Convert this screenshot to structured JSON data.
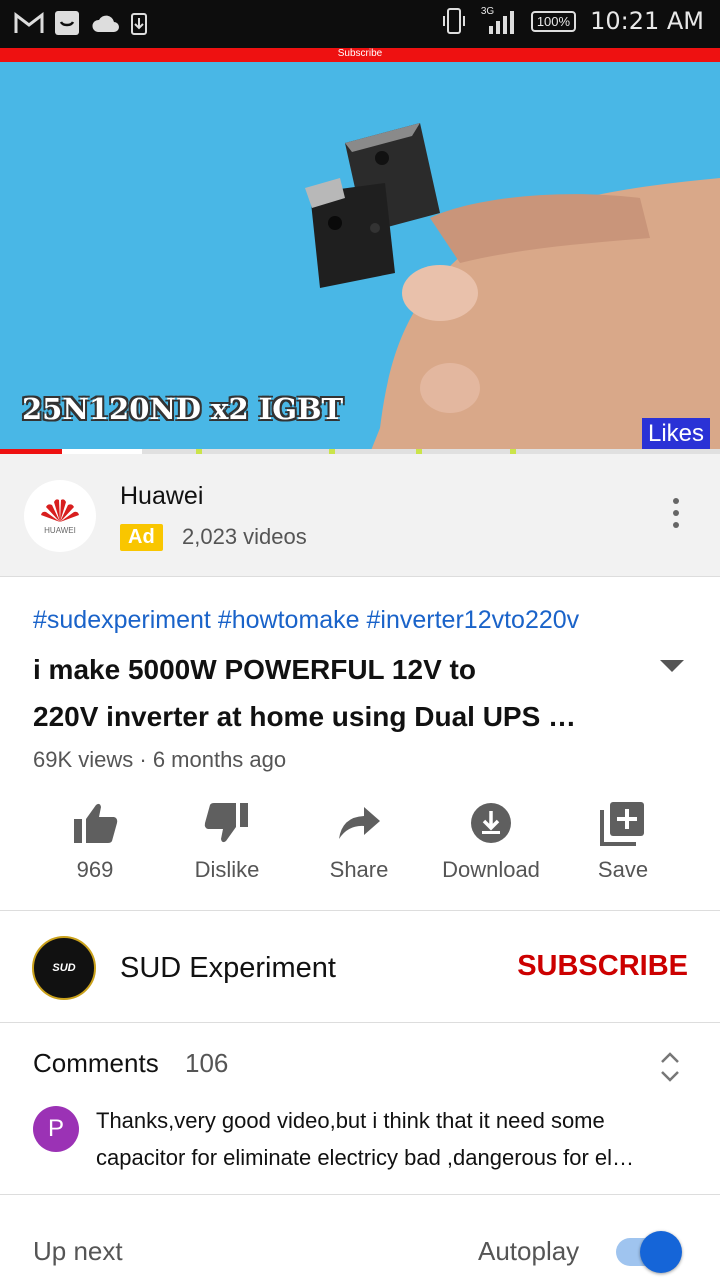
{
  "status_bar": {
    "time": "10:21 AM",
    "network": "3G",
    "battery": "100%"
  },
  "video": {
    "top_text": "Subscribe",
    "overlay_text": "25N120ND x2 IGBT",
    "likes_overlay": "Likes",
    "progress_fraction": 0.086
  },
  "ad": {
    "name": "Huawei",
    "logo_text": "HUAWEI",
    "badge": "Ad",
    "videos": "2,023 videos"
  },
  "video_info": {
    "hashtags": "#sudexperiment #howtomake #inverter12vto220v",
    "title_line1": "i make 5000W POWERFUL 12V to",
    "title_line2": "220V inverter at home using Dual UPS …",
    "meta": "69K views · 6 months ago"
  },
  "actions": [
    {
      "label": "969",
      "icon": "thumbs-up-icon"
    },
    {
      "label": "Dislike",
      "icon": "thumbs-down-icon"
    },
    {
      "label": "Share",
      "icon": "share-arrow-icon"
    },
    {
      "label": "Download",
      "icon": "download-icon"
    },
    {
      "label": "Save",
      "icon": "add-to-playlist-icon"
    }
  ],
  "channel": {
    "name": "SUD Experiment",
    "avatar_text": "SUD",
    "subscribe_label": "SUBSCRIBE"
  },
  "comments": {
    "heading": "Comments",
    "count": "106",
    "top_comment": {
      "avatar_letter": "P",
      "line1": "Thanks,very good video,but i think that it need some",
      "line2": "capacitor for eliminate electricy bad ,dangerous for el…"
    }
  },
  "up_next": {
    "label": "Up next",
    "autoplay_label": "Autoplay",
    "autoplay_on": true
  },
  "colors": {
    "accent_red": "#cc0000",
    "link_blue": "#1a63c9",
    "ad_yellow": "#f9c600",
    "toggle_blue": "#1565d8"
  }
}
